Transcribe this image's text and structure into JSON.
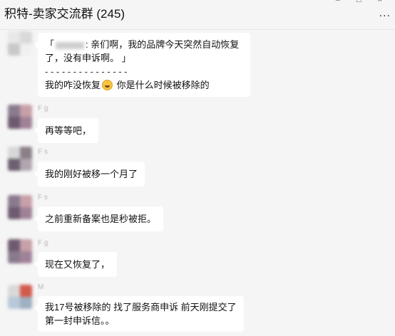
{
  "header": {
    "title": "积特-卖家交流群 (245)",
    "more_label": "...",
    "window_controls": "– □ ×"
  },
  "messages": [
    {
      "nick": "",
      "quote_line1_suffix": ": 亲们啊，我的品牌今天突然自动恢复",
      "quote_line1_prefix": "「",
      "quote_line2": "了，没有申诉啊。 」",
      "divider": "- - - - - - - - - - - - - - -",
      "reply_before_emoji": "我的咋没恢复",
      "reply_after_emoji": " 你是什么时候被移除的",
      "avatar_colors": [
        "#e8e8e8",
        "#d9d9d9",
        "#c8c8c8",
        "#f0f0f0"
      ]
    },
    {
      "nick": "F g",
      "text": "再等等吧，",
      "avatar_colors": [
        "#8a7a8e",
        "#c7a0a8",
        "#6e5a70",
        "#a08298"
      ]
    },
    {
      "nick": "F     s",
      "text": "我的刚好被移一个月了",
      "avatar_colors": [
        "#d8d8d8",
        "#8c8088",
        "#6d6070",
        "#b0a6b0"
      ]
    },
    {
      "nick": "F     s",
      "text": "之前重新备案也是秒被拒。",
      "avatar_colors": [
        "#8a7a8e",
        "#c7a0a8",
        "#6e5a70",
        "#a08298"
      ]
    },
    {
      "nick": "F g",
      "text": "现在又恢复了，",
      "avatar_colors": [
        "#6e5a70",
        "#c7a0a8",
        "#8a7a8e",
        "#a08298"
      ]
    },
    {
      "nick": "M",
      "text_line1": "我17号被移除的 找了服务商申诉 前天刚提交了",
      "text_line2": "第一封申诉信。。",
      "avatar_colors": [
        "#d9d9d9",
        "#d35a4a",
        "#b8c8d8",
        "#9fb0c0"
      ]
    }
  ]
}
